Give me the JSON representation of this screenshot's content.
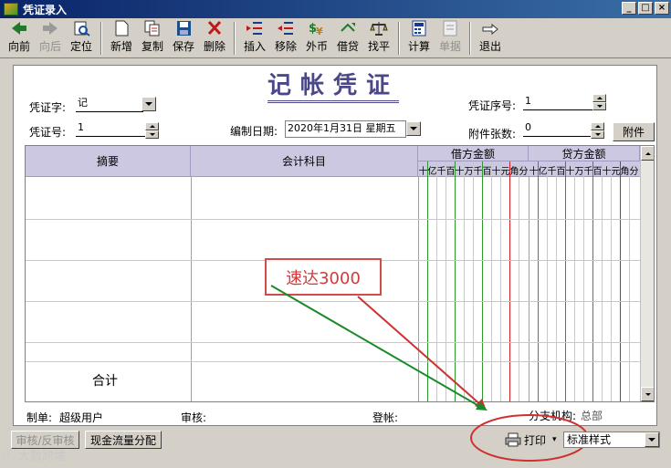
{
  "window": {
    "title": "凭证录入",
    "buttons": [
      "_",
      "□",
      "×"
    ]
  },
  "toolbar": {
    "items": [
      {
        "name": "prev",
        "label": "向前",
        "enabled": true
      },
      {
        "name": "next",
        "label": "向后",
        "enabled": false
      },
      {
        "name": "locate",
        "label": "定位",
        "enabled": true
      },
      {
        "name": "new",
        "label": "新增",
        "enabled": true
      },
      {
        "name": "copy",
        "label": "复制",
        "enabled": true
      },
      {
        "name": "save",
        "label": "保存",
        "enabled": true
      },
      {
        "name": "delete",
        "label": "删除",
        "enabled": true
      },
      {
        "name": "insert",
        "label": "插入",
        "enabled": true
      },
      {
        "name": "remove",
        "label": "移除",
        "enabled": true
      },
      {
        "name": "foreign",
        "label": "外币",
        "enabled": true
      },
      {
        "name": "debit-credit",
        "label": "借贷",
        "enabled": true
      },
      {
        "name": "balance",
        "label": "找平",
        "enabled": true
      },
      {
        "name": "calc",
        "label": "计算",
        "enabled": true
      },
      {
        "name": "doc",
        "label": "单据",
        "enabled": false
      },
      {
        "name": "exit",
        "label": "退出",
        "enabled": true
      }
    ]
  },
  "voucher": {
    "title": "记帐凭证",
    "word_label": "凭证字:",
    "word_value": "记",
    "no_label": "凭证号:",
    "no_value": "1",
    "date_label": "编制日期:",
    "date_value": "2020年1月31日 星期五",
    "seq_label": "凭证序号:",
    "seq_value": "1",
    "attach_label": "附件张数:",
    "attach_value": "0",
    "attach_button": "附件"
  },
  "grid": {
    "col_summary": "摘要",
    "col_account": "会计科目",
    "col_debit": "借方金额",
    "col_credit": "贷方金额",
    "digits": [
      "十",
      "亿",
      "千",
      "百",
      "十",
      "万",
      "千",
      "百",
      "十",
      "元",
      "角",
      "分"
    ],
    "total_label": "合计"
  },
  "footer": {
    "maker_label": "制单:",
    "maker_value": "超级用户",
    "review_label": "审核:",
    "post_label": "登帐:",
    "branch_label": "分支机构:",
    "branch_value": "总部"
  },
  "callout": {
    "text": "速达3000"
  },
  "bottom": {
    "review_button": "审核/反审核",
    "cashflow_button": "现金流量分配",
    "print_button": "打印",
    "style_value": "标准样式"
  },
  "watermark": "大数跨境",
  "colors": {
    "accent": "#4a4888",
    "header": "#ccc8e2",
    "callout": "#d24a4a"
  }
}
